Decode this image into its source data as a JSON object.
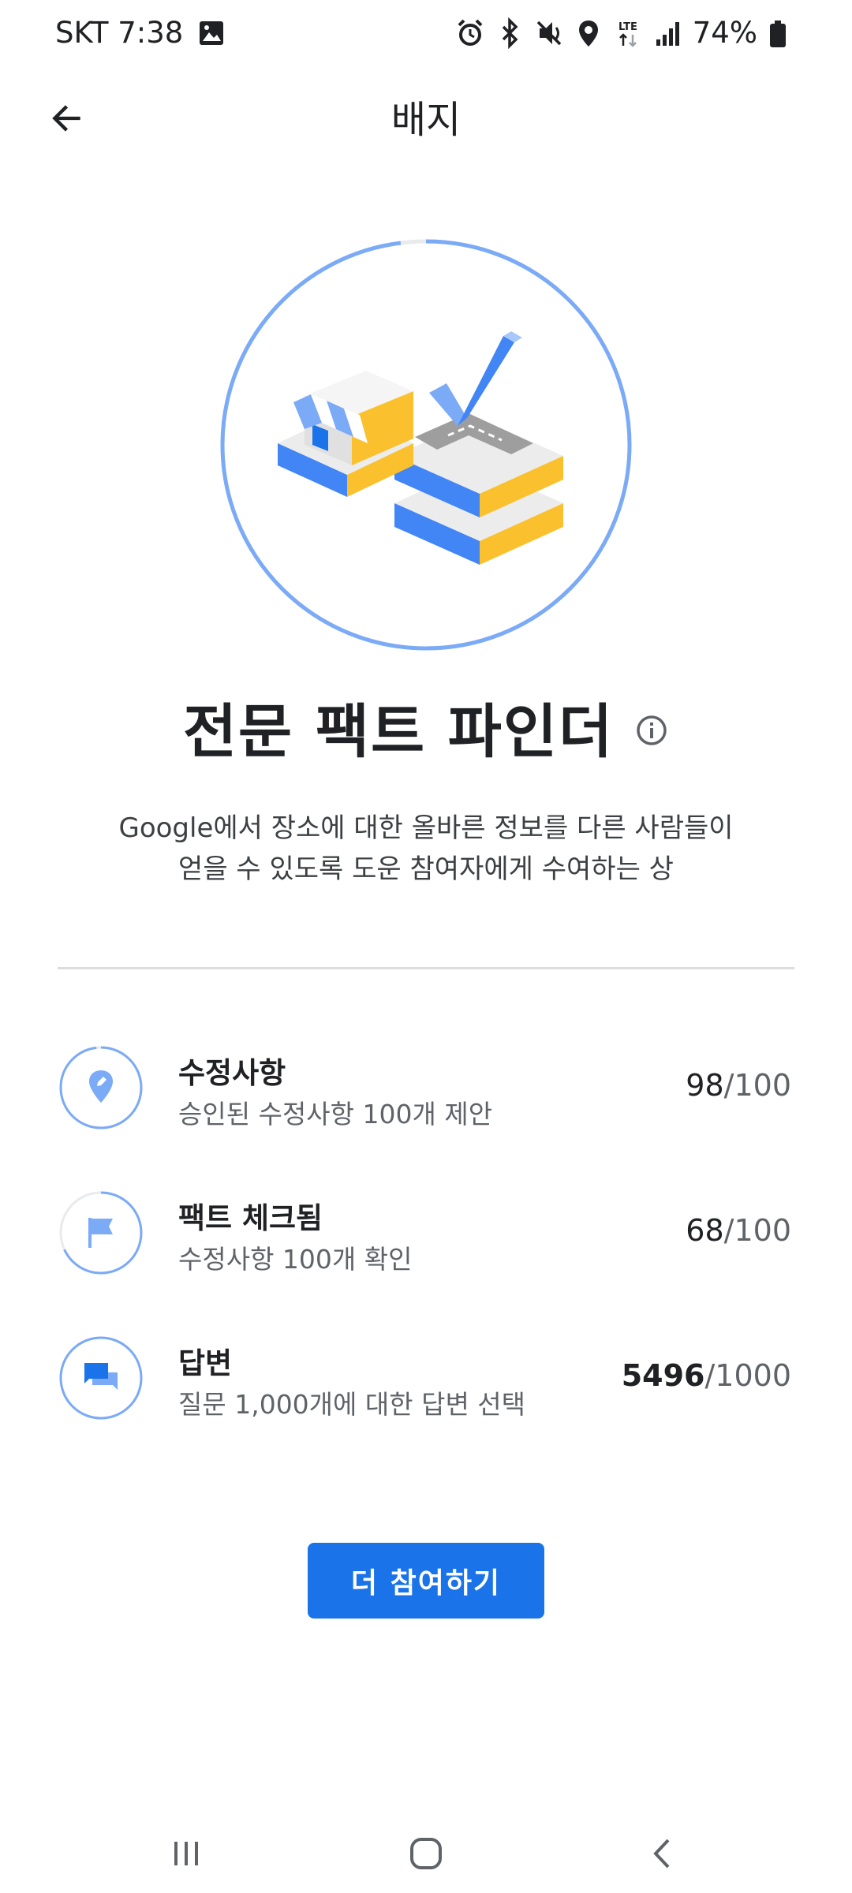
{
  "status_bar": {
    "carrier_time": "SKT 7:38",
    "network": "LTE",
    "battery": "74%"
  },
  "app_bar": {
    "title": "배지"
  },
  "badge": {
    "title": "전문 팩트 파인더",
    "description_line1": "Google에서 장소에 대한 올바른 정보를 다른 사람들이",
    "description_line2": "얻을 수 있도록 도운 참여자에게 수여하는 상",
    "progress_fraction": 0.98
  },
  "progress": [
    {
      "title": "수정사항",
      "subtitle": "승인된 수정사항 100개 제안",
      "current": "98",
      "total": "/100",
      "icon": "pin-icon",
      "fraction": 0.98
    },
    {
      "title": "팩트 체크됨",
      "subtitle": "수정사항 100개 확인",
      "current": "68",
      "total": "/100",
      "icon": "flag-icon",
      "fraction": 0.68
    },
    {
      "title": "답변",
      "subtitle": "질문 1,000개에 대한 답변 선택",
      "current": "5496",
      "total": "/1000",
      "icon": "chat-icon",
      "fraction": 1.0
    }
  ],
  "cta": {
    "label": "더 참여하기"
  },
  "colors": {
    "accent": "#1a73e8",
    "ring": "#7baaf7",
    "ring_track": "#e8eaed"
  }
}
